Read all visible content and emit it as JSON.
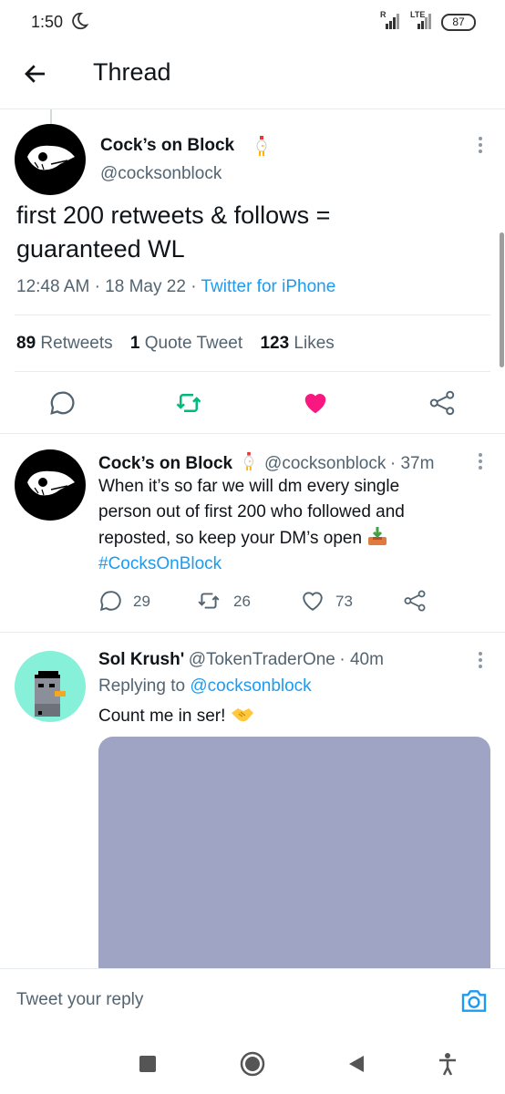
{
  "status_bar": {
    "time": "1:50",
    "signal_label_1": "R",
    "signal_label_2": "LTE",
    "battery": "87"
  },
  "app_bar": {
    "title": "Thread"
  },
  "main_tweet": {
    "author_name": "Cock’s on Block",
    "handle": "@cocksonblock",
    "text_line1": "first 200 retweets & follows =",
    "text_line2": "guaranteed WL",
    "time": "12:48 AM",
    "date": "18 May 22",
    "source": "Twitter for iPhone",
    "retweets_count": "89",
    "retweets_label": "Retweets",
    "quotes_count": "1",
    "quotes_label": "Quote Tweet",
    "likes_count": "123",
    "likes_label": "Likes",
    "liked": true,
    "retweeted": true
  },
  "reply_1": {
    "author_name": "Cock’s on Block",
    "handle": "@cocksonblock",
    "age": "37m",
    "line1": "When it’s so far we will dm every single",
    "line2": "person out of first 200 who followed and",
    "line3": "reposted, so keep your DM’s open",
    "hashtag": "#CocksOnBlock",
    "replies": "29",
    "retweets": "26",
    "likes": "73"
  },
  "reply_2": {
    "author_name": "Sol Krush'",
    "handle": "@TokenTraderOne",
    "age": "40m",
    "replying_prefix": "Replying to",
    "replying_to": "@cocksonblock",
    "text": "Count me in ser!"
  },
  "composer": {
    "placeholder": "Tweet your reply"
  },
  "colors": {
    "accent": "#1d9bf0",
    "like": "#f91880",
    "retweet": "#00ba7c",
    "media_placeholder": "#a0a4c4"
  }
}
